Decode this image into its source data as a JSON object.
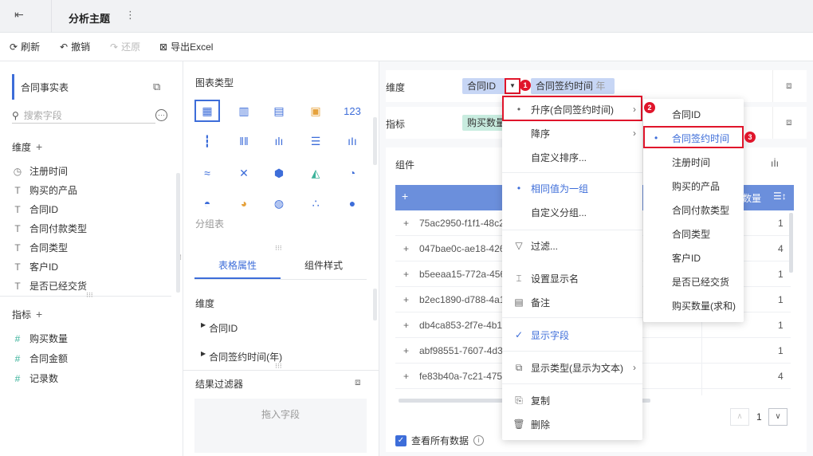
{
  "topbar": {
    "title": "分析主题",
    "back_icon": "exit-icon",
    "more_icon": "more-vertical-icon"
  },
  "toolbar": {
    "refresh": "刷新",
    "undo": "撤销",
    "redo": "还原",
    "export": "导出Excel"
  },
  "left": {
    "table_name": "合同事实表",
    "search_placeholder": "搜索字段",
    "dimension_header": "维度",
    "dimension_fields": [
      {
        "icon": "◷",
        "label": "注册时间"
      },
      {
        "icon": "T",
        "label": "购买的产品"
      },
      {
        "icon": "T",
        "label": "合同ID"
      },
      {
        "icon": "T",
        "label": "合同付款类型"
      },
      {
        "icon": "T",
        "label": "合同类型"
      },
      {
        "icon": "T",
        "label": "客户ID"
      },
      {
        "icon": "T",
        "label": "是否已经交货"
      }
    ],
    "metric_header": "指标",
    "metric_fields": [
      {
        "icon": "#",
        "label": "购买数量"
      },
      {
        "icon": "#",
        "label": "合同金额"
      },
      {
        "icon": "#",
        "label": "记录数"
      }
    ]
  },
  "center": {
    "chart_type_title": "图表类型",
    "chart_type_label": "分组表",
    "tab_table": "表格属性",
    "tab_style": "组件样式",
    "dimension_label": "维度",
    "dim_items": [
      "合同ID",
      "合同签约时间(年)"
    ],
    "filter_title": "结果过滤器",
    "drop_hint": "拖入字段"
  },
  "right": {
    "dimension_label": "维度",
    "metric_label": "指标",
    "dim_pill1": "合同ID",
    "dim_pill2": "合同签约时间",
    "dim_pill2_suffix": "年",
    "metric_pill": "购买数量",
    "component_label": "组件",
    "col_header_right": "数量",
    "rows": [
      {
        "id": "75ac2950-f1f1-48c2",
        "val": "1"
      },
      {
        "id": "047bae0c-ae18-426",
        "val": "4"
      },
      {
        "id": "b5eeaa15-772a-456",
        "val": "1"
      },
      {
        "id": "b2ec1890-d788-4a1",
        "val": "1"
      },
      {
        "id": "db4ca853-2f7e-4b1",
        "val": "1"
      },
      {
        "id": "abf98551-7607-4d3",
        "val": "1"
      },
      {
        "id": "fe83b40a-7c21-475",
        "val": "4"
      }
    ],
    "view_all": "查看所有数据",
    "page": "1"
  },
  "menu": {
    "items": [
      {
        "label": "升序(合同签约时间)",
        "icon": "•",
        "blue": false,
        "arrow": true
      },
      {
        "label": "降序",
        "icon": "",
        "blue": false,
        "arrow": true
      },
      {
        "label": "自定义排序...",
        "icon": "",
        "blue": false,
        "arrow": false
      },
      {
        "label": "相同值为一组",
        "icon": "•",
        "blue": true,
        "arrow": false
      },
      {
        "label": "自定义分组...",
        "icon": "",
        "blue": false,
        "arrow": false
      },
      {
        "label": "过滤...",
        "icon": "▽",
        "blue": false,
        "arrow": false
      },
      {
        "label": "设置显示名",
        "icon": "⌶",
        "blue": false,
        "arrow": false
      },
      {
        "label": "备注",
        "icon": "▤",
        "blue": false,
        "arrow": false
      },
      {
        "label": "显示字段",
        "icon": "✓",
        "blue": true,
        "arrow": false
      },
      {
        "label": "显示类型(显示为文本)",
        "icon": "⧉",
        "blue": false,
        "arrow": true
      },
      {
        "label": "复制",
        "icon": "⎘",
        "blue": false,
        "arrow": false
      },
      {
        "label": "删除",
        "icon": "🗑",
        "blue": false,
        "arrow": false
      }
    ]
  },
  "submenu": {
    "items": [
      "合同ID",
      "合同签约时间",
      "注册时间",
      "购买的产品",
      "合同付款类型",
      "合同类型",
      "客户ID",
      "是否已经交货",
      "购买数量(求和)"
    ]
  },
  "badges": [
    "1",
    "2",
    "3"
  ],
  "colors": {
    "accent": "#3d6dd9",
    "badge": "#e0152b"
  }
}
